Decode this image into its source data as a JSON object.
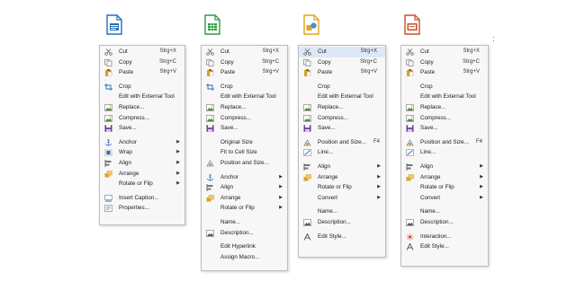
{
  "apps": [
    {
      "name": "writer",
      "color": "#2a6db5",
      "items": [
        {
          "label": "Cut",
          "icon": "scissors-icon",
          "shortcut": "Strg+X"
        },
        {
          "label": "Copy",
          "icon": "copy-icon",
          "shortcut": "Strg+C"
        },
        {
          "label": "Paste",
          "icon": "paste-icon",
          "shortcut": "Strg+V"
        },
        {
          "sep": true
        },
        {
          "label": "Crop",
          "icon": "crop-icon"
        },
        {
          "label": "Edit with External Tool"
        },
        {
          "label": "Replace...",
          "icon": "image-icon"
        },
        {
          "label": "Compress...",
          "icon": "image-icon"
        },
        {
          "label": "Save...",
          "icon": "save-icon"
        },
        {
          "sep": true
        },
        {
          "label": "Anchor",
          "icon": "anchor-icon",
          "submenu": true
        },
        {
          "label": "Wrap",
          "icon": "wrap-icon",
          "submenu": true
        },
        {
          "label": "Align",
          "icon": "align-icon",
          "submenu": true
        },
        {
          "label": "Arrange",
          "icon": "arrange-icon",
          "submenu": true
        },
        {
          "label": "Rotate or Flip",
          "submenu": true
        },
        {
          "sep": true
        },
        {
          "label": "Insert Caption...",
          "icon": "caption-icon"
        },
        {
          "label": "Properties...",
          "icon": "properties-icon"
        }
      ]
    },
    {
      "name": "calc",
      "color": "#2e9a3c",
      "items": [
        {
          "label": "Cut",
          "icon": "scissors-icon",
          "shortcut": "Strg+X"
        },
        {
          "label": "Copy",
          "icon": "copy-icon",
          "shortcut": "Strg+C"
        },
        {
          "label": "Paste",
          "icon": "paste-icon",
          "shortcut": "Strg+V"
        },
        {
          "sep": true
        },
        {
          "label": "Crop",
          "icon": "crop-icon"
        },
        {
          "label": "Edit with External Tool"
        },
        {
          "label": "Replace...",
          "icon": "image-icon"
        },
        {
          "label": "Compress...",
          "icon": "image-icon"
        },
        {
          "label": "Save...",
          "icon": "save-icon"
        },
        {
          "sep": true
        },
        {
          "label": "Original Size"
        },
        {
          "label": "Fit to Cell Size"
        },
        {
          "label": "Position and Size...",
          "icon": "position-size-icon"
        },
        {
          "sep": true
        },
        {
          "label": "Anchor",
          "icon": "anchor-icon",
          "submenu": true
        },
        {
          "label": "Align",
          "icon": "align-icon",
          "submenu": true
        },
        {
          "label": "Arrange",
          "icon": "arrange-icon",
          "submenu": true
        },
        {
          "label": "Rotate or Flip",
          "submenu": true
        },
        {
          "sep": true
        },
        {
          "label": "Name..."
        },
        {
          "label": "Description...",
          "icon": "description-icon"
        },
        {
          "sep": true
        },
        {
          "label": "Edit Hyperlink"
        },
        {
          "label": "Assign Macro..."
        }
      ]
    },
    {
      "name": "draw",
      "color": "#e0a21a",
      "items": [
        {
          "label": "Cut",
          "icon": "scissors-icon",
          "shortcut": "Strg+X",
          "highlight": true
        },
        {
          "label": "Copy",
          "icon": "copy-icon",
          "shortcut": "Strg+C"
        },
        {
          "label": "Paste",
          "icon": "paste-icon",
          "shortcut": "Strg+V"
        },
        {
          "sep": true
        },
        {
          "label": "Crop"
        },
        {
          "label": "Edit with External Tool"
        },
        {
          "label": "Replace...",
          "icon": "image-icon"
        },
        {
          "label": "Compress...",
          "icon": "image-icon"
        },
        {
          "label": "Save...",
          "icon": "save-icon"
        },
        {
          "sep": true
        },
        {
          "label": "Position and Size...",
          "icon": "position-size-icon",
          "shortcut": "F4",
          "near": true
        },
        {
          "label": "Line...",
          "icon": "line-icon"
        },
        {
          "sep": true
        },
        {
          "label": "Align",
          "icon": "align-icon",
          "submenu": true
        },
        {
          "label": "Arrange",
          "icon": "arrange-icon",
          "submenu": true
        },
        {
          "label": "Rotate or Flip",
          "submenu": true
        },
        {
          "label": "Convert",
          "submenu": true
        },
        {
          "sep": true
        },
        {
          "label": "Name..."
        },
        {
          "label": "Description...",
          "icon": "description-icon"
        },
        {
          "sep": true
        },
        {
          "label": "Edit Style...",
          "icon": "edit-style-icon"
        }
      ]
    },
    {
      "name": "impress",
      "color": "#c7502a",
      "items": [
        {
          "label": "Cut",
          "icon": "scissors-icon",
          "shortcut": "Strg+X"
        },
        {
          "label": "Copy",
          "icon": "copy-icon",
          "shortcut": "Strg+C"
        },
        {
          "label": "Paste",
          "icon": "paste-icon",
          "shortcut": "Strg+V"
        },
        {
          "sep": true
        },
        {
          "label": "Crop"
        },
        {
          "label": "Edit with External Tool"
        },
        {
          "label": "Replace...",
          "icon": "image-icon"
        },
        {
          "label": "Compress...",
          "icon": "image-icon"
        },
        {
          "label": "Save...",
          "icon": "save-icon"
        },
        {
          "sep": true
        },
        {
          "label": "Position and Size...",
          "icon": "position-size-icon",
          "shortcut": "F4",
          "near": true
        },
        {
          "label": "Line...",
          "icon": "line-icon"
        },
        {
          "sep": true
        },
        {
          "label": "Align",
          "icon": "align-icon",
          "submenu": true
        },
        {
          "label": "Arrange",
          "icon": "arrange-icon",
          "submenu": true
        },
        {
          "label": "Rotate or Flip",
          "submenu": true
        },
        {
          "label": "Convert",
          "submenu": true
        },
        {
          "sep": true
        },
        {
          "label": "Name..."
        },
        {
          "label": "Description...",
          "icon": "description-icon"
        },
        {
          "sep": true
        },
        {
          "label": "Interaction...",
          "icon": "interaction-icon"
        },
        {
          "label": "Edit Style...",
          "icon": "edit-style-icon"
        }
      ]
    }
  ]
}
